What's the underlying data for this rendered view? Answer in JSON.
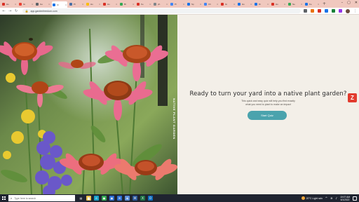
{
  "browser": {
    "tabs": [
      {
        "title": "Ho",
        "favicon_color": "#d93025"
      },
      {
        "title": "Gi",
        "favicon_color": "#ea4335"
      },
      {
        "title": "Go",
        "favicon_color": "#5f6368"
      },
      {
        "title": "Cr",
        "favicon_color": "#1a73e8",
        "active": true
      },
      {
        "title": "Pr",
        "favicon_color": "#4a6fa5"
      },
      {
        "title": "Ho",
        "favicon_color": "#fbbc04"
      },
      {
        "title": "Ho",
        "favicon_color": "#d93025"
      },
      {
        "title": "Bl",
        "favicon_color": "#34a853"
      },
      {
        "title": "Fe",
        "favicon_color": "#d93025"
      },
      {
        "title": "ph",
        "favicon_color": "#80868b"
      },
      {
        "title": "Pr",
        "favicon_color": "#4285f4"
      },
      {
        "title": "Sp",
        "favicon_color": "#1a73e8"
      },
      {
        "title": "Ch",
        "favicon_color": "#4285f4"
      },
      {
        "title": "Gi",
        "favicon_color": "#d93025"
      },
      {
        "title": "Ho",
        "favicon_color": "#1a73e8"
      },
      {
        "title": "Di",
        "favicon_color": "#1a73e8"
      },
      {
        "title": "Ho",
        "favicon_color": "#d93025"
      },
      {
        "title": "Ne",
        "favicon_color": "#34a853"
      },
      {
        "title": "Fe",
        "favicon_color": "#1a73e8"
      }
    ],
    "new_tab_label": "+",
    "window_controls": {
      "minimize": "–",
      "maximize": "▢",
      "close": "✕"
    },
    "nav": {
      "back": "←",
      "forward": "→",
      "reload": "↻"
    },
    "url": "app.gardenfreedom.com",
    "extension_colors": [
      "#5f6368",
      "#e8710a",
      "#d93025",
      "#1a73e8",
      "#188038",
      "#9334e6"
    ]
  },
  "page": {
    "photo_logo_text": "NATIVE PLANT GARDEN",
    "headline": "Ready to turn your yard into a native plant garden?",
    "subtext_line1": "This quick and easy quiz will help you find exactly",
    "subtext_line2": "what you need to plant to make an impact",
    "start_button_label": "Start Quiz",
    "side_badge_letter": "Z",
    "accent_color": "#4aa3ad",
    "badge_color": "#e23b2e"
  },
  "taskbar": {
    "search_placeholder": "Type here to search",
    "app_icons": [
      {
        "name": "task-view-icon",
        "glyph": "▤",
        "color": "#1f2430"
      },
      {
        "name": "file-explorer-icon",
        "glyph": "▆",
        "color": "#f2c14e"
      },
      {
        "name": "edge-icon",
        "glyph": "e",
        "color": "#1aa1c9"
      },
      {
        "name": "chrome-icon",
        "glyph": "●",
        "color": "#34a853"
      },
      {
        "name": "store-icon",
        "glyph": "▣",
        "color": "#2d6fd2"
      },
      {
        "name": "mail-icon",
        "glyph": "✉",
        "color": "#2d6fd2"
      },
      {
        "name": "photos-icon",
        "glyph": "◈",
        "color": "#5b8fd9"
      },
      {
        "name": "word-icon",
        "glyph": "W",
        "color": "#2b579a"
      },
      {
        "name": "excel-icon",
        "glyph": "X",
        "color": "#217346"
      },
      {
        "name": "outlook-icon",
        "glyph": "O",
        "color": "#0f6cbd"
      }
    ],
    "weather": "20°C Light rain",
    "time": "10:07 AM",
    "date": "6/1/2022"
  }
}
